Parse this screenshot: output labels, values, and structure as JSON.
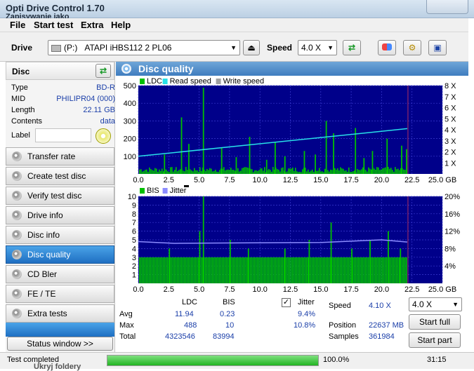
{
  "window": {
    "title": "Opti Drive Control 1.70",
    "subtitle": "Zapisywanie jako"
  },
  "menu": [
    "File",
    "Start test",
    "Extra",
    "Help"
  ],
  "toolbar": {
    "drive_label": "Drive",
    "drive_letter": "(P:)",
    "drive_name": "ATAPI iHBS112  2 PL06",
    "speed_label": "Speed",
    "speed_value": "4.0 X"
  },
  "disc": {
    "header": "Disc",
    "rows": [
      {
        "key": "Type",
        "value": "BD-R"
      },
      {
        "key": "MID",
        "value": "PHILIPR04 (000)"
      },
      {
        "key": "Length",
        "value": "22.11 GB"
      },
      {
        "key": "Contents",
        "value": "data"
      }
    ],
    "label_key": "Label"
  },
  "nav": [
    {
      "label": "Transfer rate",
      "active": false
    },
    {
      "label": "Create test disc",
      "active": false
    },
    {
      "label": "Verify test disc",
      "active": false
    },
    {
      "label": "Drive info",
      "active": false
    },
    {
      "label": "Disc info",
      "active": false
    },
    {
      "label": "Disc quality",
      "active": true
    },
    {
      "label": "CD Bler",
      "active": false
    },
    {
      "label": "FE / TE",
      "active": false
    },
    {
      "label": "Extra tests",
      "active": false
    }
  ],
  "status_window_btn": "Status window >>",
  "panel_title": "Disc quality",
  "chart_data": [
    {
      "type": "bar",
      "legend": [
        "LDC",
        "Read speed",
        "Write speed"
      ],
      "colors": {
        "LDC": "#00c000",
        "Read speed": "#28e0e8",
        "Write speed": "#a0a0a0"
      },
      "x_ticks": [
        "0.0",
        "2.5",
        "5.0",
        "7.5",
        "10.0",
        "12.5",
        "15.0",
        "17.5",
        "20.0",
        "22.5",
        "25.0 GB"
      ],
      "y_ticks_left": [
        "500",
        "400",
        "300",
        "200",
        "100"
      ],
      "y_ticks_right": [
        "8 X",
        "7 X",
        "6 X",
        "5 X",
        "4 X",
        "3 X",
        "2 X",
        "1 X"
      ],
      "xlim": [
        0,
        25
      ],
      "ylim": [
        0,
        500
      ],
      "y2lim": [
        0,
        8
      ],
      "data_end_gb": 22.11,
      "read_speed": {
        "x": [
          0,
          22.11
        ],
        "y": [
          1.6,
          4.1
        ]
      },
      "ldc_baseline": 25,
      "ldc_peaks": [
        {
          "x": 3.5,
          "y": 320
        },
        {
          "x": 5.3,
          "y": 488
        },
        {
          "x": 4.1,
          "y": 170
        },
        {
          "x": 6.8,
          "y": 150
        },
        {
          "x": 9.1,
          "y": 210
        },
        {
          "x": 11.2,
          "y": 180
        },
        {
          "x": 13.6,
          "y": 130
        },
        {
          "x": 15.4,
          "y": 300
        },
        {
          "x": 16.0,
          "y": 230
        },
        {
          "x": 17.8,
          "y": 260
        },
        {
          "x": 19.2,
          "y": 130
        },
        {
          "x": 20.4,
          "y": 200
        },
        {
          "x": 21.6,
          "y": 160
        },
        {
          "x": 22.0,
          "y": 140
        },
        {
          "x": 2.1,
          "y": 110
        },
        {
          "x": 8.0,
          "y": 95
        },
        {
          "x": 12.0,
          "y": 100
        },
        {
          "x": 14.5,
          "y": 110
        },
        {
          "x": 18.5,
          "y": 90
        },
        {
          "x": 10.5,
          "y": 80
        }
      ]
    },
    {
      "type": "bar",
      "legend": [
        "BIS",
        "Jitter"
      ],
      "colors": {
        "BIS": "#00c000",
        "Jitter": "#8c8cff"
      },
      "x_ticks": [
        "0.0",
        "2.5",
        "5.0",
        "7.5",
        "10.0",
        "12.5",
        "15.0",
        "17.5",
        "20.0",
        "22.5",
        "25.0 GB"
      ],
      "y_ticks_left": [
        "10",
        "9",
        "8",
        "7",
        "6",
        "5",
        "4",
        "3",
        "2",
        "1"
      ],
      "y_ticks_right": [
        "20%",
        "16%",
        "12%",
        "8%",
        "4%"
      ],
      "xlim": [
        0,
        25
      ],
      "ylim": [
        0,
        10
      ],
      "y2lim": [
        0,
        20
      ],
      "data_end_gb": 22.11,
      "bis_baseline": 3,
      "bis_peaks": [
        {
          "x": 2.5,
          "y": 4
        },
        {
          "x": 5.3,
          "y": 10
        },
        {
          "x": 5.0,
          "y": 6
        },
        {
          "x": 7.5,
          "y": 5
        },
        {
          "x": 9.0,
          "y": 4
        },
        {
          "x": 12.0,
          "y": 4
        },
        {
          "x": 14.0,
          "y": 5
        },
        {
          "x": 15.8,
          "y": 7
        },
        {
          "x": 17.5,
          "y": 4
        },
        {
          "x": 19.0,
          "y": 5
        },
        {
          "x": 20.5,
          "y": 6
        },
        {
          "x": 21.5,
          "y": 4
        }
      ],
      "jitter": {
        "x": [
          0,
          3,
          8,
          15,
          20,
          22.11
        ],
        "y": [
          9.6,
          9.2,
          9.3,
          9.4,
          10.0,
          9.5
        ]
      }
    }
  ],
  "stats": {
    "col_ldc": "LDC",
    "col_bis": "BIS",
    "col_jitter": "Jitter",
    "avg_label": "Avg",
    "max_label": "Max",
    "total_label": "Total",
    "avg_ldc": "11.94",
    "avg_bis": "0.23",
    "avg_jitter": "9.4%",
    "max_ldc": "488",
    "max_bis": "10",
    "max_jitter": "10.8%",
    "total_ldc": "4323546",
    "total_bis": "83994",
    "speed_label": "Speed",
    "speed_value": "4.10 X",
    "position_label": "Position",
    "position_value": "22637 MB",
    "samples_label": "Samples",
    "samples_value": "361984",
    "speed_select": "4.0 X",
    "start_full": "Start full",
    "start_part": "Start part"
  },
  "status": {
    "text": "Test completed",
    "progress_percent": 100,
    "progress_text": "100.0%",
    "time": "31:15",
    "behind_text": "Ukryj foldery"
  }
}
